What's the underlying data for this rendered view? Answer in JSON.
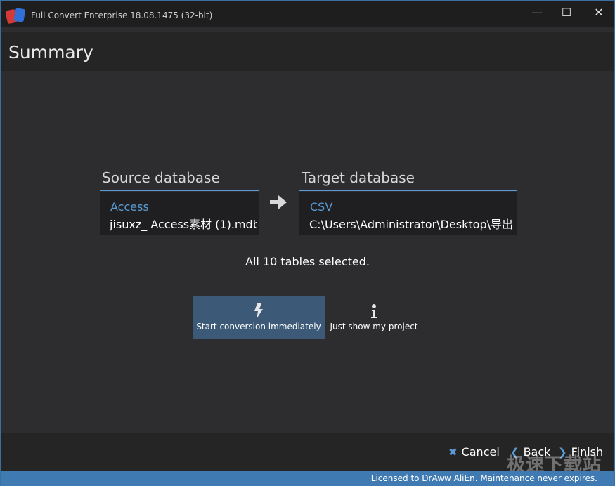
{
  "window": {
    "title": "Full Convert Enterprise 18.08.1475 (32-bit)",
    "minimize_symbol": "—",
    "maximize_symbol": "☐",
    "close_symbol": "✕"
  },
  "header": {
    "title": "Summary"
  },
  "source": {
    "heading": "Source database",
    "kind": "Access",
    "path": "jisuxz_ Access素材 (1).mdb"
  },
  "target": {
    "heading": "Target database",
    "kind": "CSV",
    "path": "C:\\Users\\Administrator\\Desktop\\导出"
  },
  "tables_selected": "All 10 tables selected.",
  "options": {
    "start_label": "Start conversion immediately",
    "start_icon": "lightning-icon",
    "show_label": "Just show my project",
    "show_icon": "info-icon"
  },
  "footer": {
    "cancel_label": "Cancel",
    "back_label": "Back",
    "finish_label": "Finish"
  },
  "status": {
    "license": "Licensed to DrAww AliEn. Maintenance never expires."
  },
  "watermark": "极速下载站",
  "colors": {
    "accent": "#5a9bd4",
    "selected_option": "#3c5a77",
    "status_bar": "#3f7ab2"
  }
}
